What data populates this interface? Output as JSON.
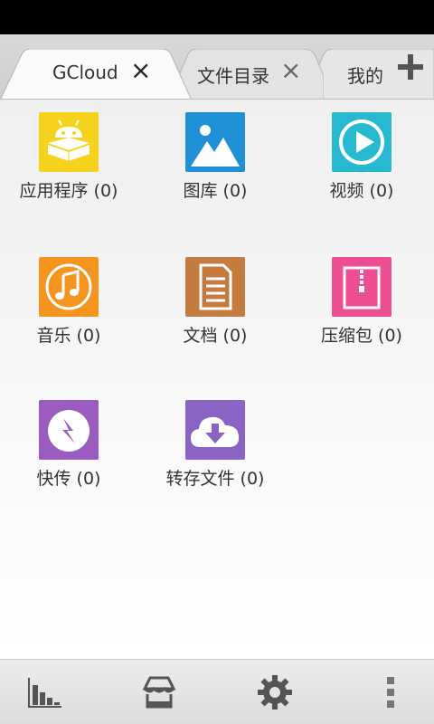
{
  "tabs": [
    {
      "label": "GCloud",
      "active": true
    },
    {
      "label": "文件目录",
      "active": false
    },
    {
      "label": "我的",
      "active": false
    }
  ],
  "categories": [
    {
      "label": "应用程序 (0)",
      "icon": "android-app-icon",
      "color": "#f6d21c"
    },
    {
      "label": "图库 (0)",
      "icon": "gallery-image-icon",
      "color": "#1f8fd6"
    },
    {
      "label": "视频 (0)",
      "icon": "video-play-icon",
      "color": "#27b9cf"
    },
    {
      "label": "音乐 (0)",
      "icon": "music-note-icon",
      "color": "#f5951f"
    },
    {
      "label": "文档 (0)",
      "icon": "document-icon",
      "color": "#c47b3f"
    },
    {
      "label": "压缩包 (0)",
      "icon": "zip-archive-icon",
      "color": "#ee4f93"
    },
    {
      "label": "快传 (0)",
      "icon": "quick-transfer-icon",
      "color": "#9b5cc0"
    },
    {
      "label": "转存文件 (0)",
      "icon": "cloud-download-icon",
      "color": "#8a63c4"
    }
  ],
  "bottom_bar": [
    {
      "icon": "statistics-chart-icon"
    },
    {
      "icon": "store-icon"
    },
    {
      "icon": "settings-gear-icon"
    },
    {
      "icon": "more-menu-icon"
    }
  ]
}
